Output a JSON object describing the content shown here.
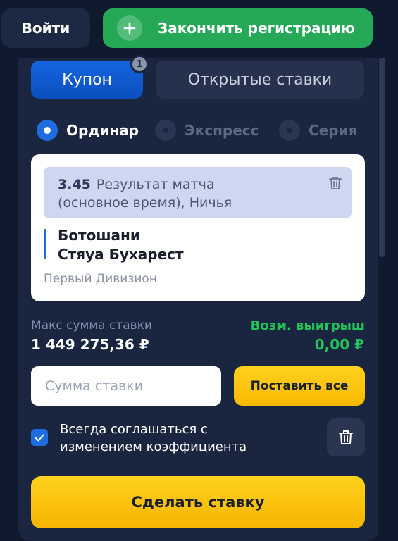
{
  "header": {
    "login_label": "Войти",
    "register_label": "Закончить регистрацию"
  },
  "tabs": {
    "coupon_label": "Купон",
    "coupon_badge": "1",
    "open_bets_label": "Открытые ставки"
  },
  "bet_types": [
    {
      "label": "Ординар",
      "selected": true
    },
    {
      "label": "Экспресс",
      "selected": false
    },
    {
      "label": "Серия",
      "selected": false
    }
  ],
  "bet": {
    "odds": "3.45",
    "market_line1": "Результат матча",
    "market_line2": "(основное время), Ничья",
    "home_team": "Ботошани",
    "away_team": "Стяуа Бухарест",
    "league": "Первый Дивизион"
  },
  "limits": {
    "max_label": "Макс сумма ставки",
    "max_value": "1 449 275,36 ₽",
    "win_label": "Возм. выигрыш",
    "win_value": "0,00 ₽"
  },
  "stake": {
    "placeholder": "Сумма ставки",
    "value": "",
    "bet_all_label": "Поставить все"
  },
  "agree": {
    "checked": true,
    "line1": "Всегда соглашаться с",
    "line2": "изменением коэффициента"
  },
  "place_bet_label": "Сделать ставку",
  "colors": {
    "background": "#0f1a2e",
    "panel": "#1a2540",
    "accent_blue": "#1f6ce0",
    "green": "#25a956",
    "win_green": "#22c35a",
    "yellow": "#ffcb0f"
  }
}
